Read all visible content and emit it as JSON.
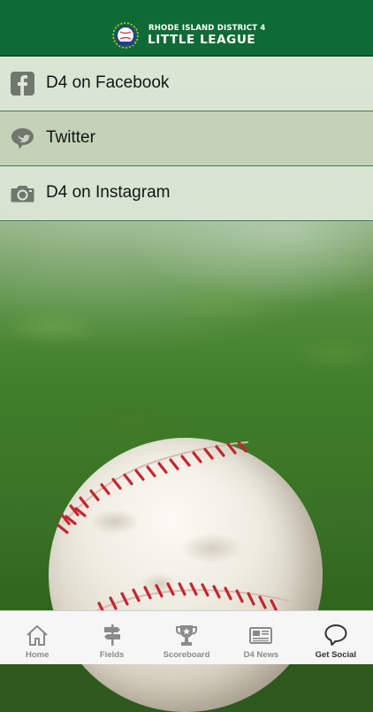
{
  "header": {
    "logo_icon": "little-league-logo-icon",
    "line1": "RHODE ISLAND DISTRICT 4",
    "line2": "LITTLE LEAGUE",
    "background_color": "#0f6b35"
  },
  "social": {
    "items": [
      {
        "label": "D4 on Facebook",
        "icon": "facebook-icon",
        "selected": false
      },
      {
        "label": "Twitter",
        "icon": "twitter-bird-bubble-icon",
        "selected": true
      },
      {
        "label": "D4 on Instagram",
        "icon": "camera-icon",
        "selected": false
      }
    ]
  },
  "background": {
    "image": "baseball-on-grass-photo"
  },
  "tabbar": {
    "active_index": 4,
    "tabs": [
      {
        "label": "Home",
        "icon": "home-icon"
      },
      {
        "label": "Fields",
        "icon": "signpost-icon"
      },
      {
        "label": "Scoreboard",
        "icon": "trophy-icon"
      },
      {
        "label": "D4 News",
        "icon": "newspaper-icon"
      },
      {
        "label": "Get Social",
        "icon": "speech-bubble-icon"
      }
    ]
  }
}
